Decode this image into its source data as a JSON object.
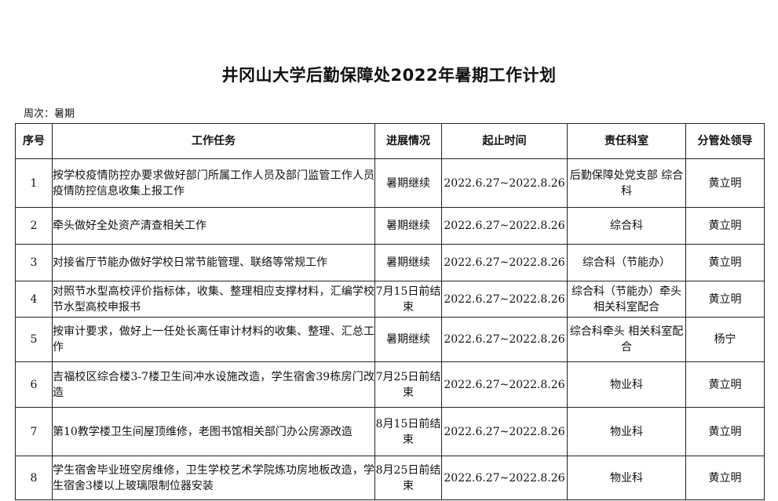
{
  "document": {
    "title": "井冈山大学后勤保障处2022年暑期工作计划",
    "week_label": "周次：暑期"
  },
  "table": {
    "headers": [
      "序号",
      "工作任务",
      "进展情况",
      "起止时间",
      "责任科室",
      "分管处领导"
    ],
    "rows": [
      {
        "no": "1",
        "task": "按学校疫情防控办要求做好部门所属工作人员及部门监管工作人员疫情防控信息收集上报工作",
        "status": "暑期继续",
        "period": "2022.6.27~2022.8.26",
        "dept": "后勤保障处党支部 综合科",
        "leader": "黄立明"
      },
      {
        "no": "2",
        "task": "牵头做好全处资产清查相关工作",
        "status": "暑期继续",
        "period": "2022.6.27~2022.8.26",
        "dept": "综合科",
        "leader": "黄立明"
      },
      {
        "no": "3",
        "task": "对接省厅节能办做好学校日常节能管理、联络等常规工作",
        "status": "暑期继续",
        "period": "2022.6.27~2022.8.26",
        "dept": "综合科（节能办）",
        "leader": "黄立明"
      },
      {
        "no": "4",
        "task": "对照节水型高校评价指标体，收集、整理相应支撑材料，汇编学校节水型高校申报书",
        "status": "7月15日前结束",
        "period": "2022.6.27~2022.8.26",
        "dept": "综合科（节能办）牵头相关科室配合",
        "leader": "黄立明"
      },
      {
        "no": "5",
        "task": "按审计要求，做好上一任处长离任审计材料的收集、整理、汇总工作",
        "status": "暑期继续",
        "period": "2022.6.27~2022.8.26",
        "dept": "综合科牵头 相关科室配合",
        "leader": "杨宁"
      },
      {
        "no": "6",
        "task": "吉福校区综合楼3-7楼卫生间冲水设施改造，学生宿舍39栋房门改造",
        "status": "7月25日前结束",
        "period": "2022.6.27~2022.8.26",
        "dept": "物业科",
        "leader": "黄立明"
      },
      {
        "no": "7",
        "task": "第10教学楼卫生间屋顶维修，老图书馆相关部门办公房源改造",
        "status": "8月15日前结束",
        "period": "2022.6.27~2022.8.26",
        "dept": "物业科",
        "leader": "黄立明"
      },
      {
        "no": "8",
        "task": "学生宿舍毕业班空房维修，卫生学校艺术学院炼功房地板改造，学生宿舍3楼以上玻璃限制位器安装",
        "status": "8月25日前结束",
        "period": "2022.6.27~2022.8.26",
        "dept": "物业科",
        "leader": "黄立明"
      }
    ]
  }
}
